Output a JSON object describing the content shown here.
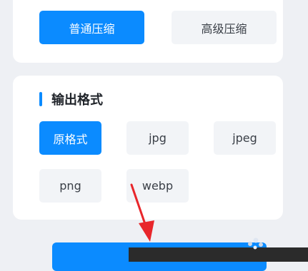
{
  "compress_mode": {
    "options": [
      {
        "label": "普通压缩",
        "selected": true
      },
      {
        "label": "高级压缩",
        "selected": false
      }
    ]
  },
  "output_format": {
    "title": "输出格式",
    "options": [
      {
        "label": "原格式",
        "selected": true
      },
      {
        "label": "jpg",
        "selected": false
      },
      {
        "label": "jpeg",
        "selected": false
      },
      {
        "label": "png",
        "selected": false
      },
      {
        "label": "webp",
        "selected": false
      }
    ]
  },
  "colors": {
    "accent": "#0b8bff",
    "background": "#eef0f4",
    "card": "#ffffff",
    "option_bg": "#f2f4f7",
    "annotation_arrow": "#e8262b"
  },
  "icons": [
    "pointer-arrow-icon",
    "sparkle-icon"
  ]
}
